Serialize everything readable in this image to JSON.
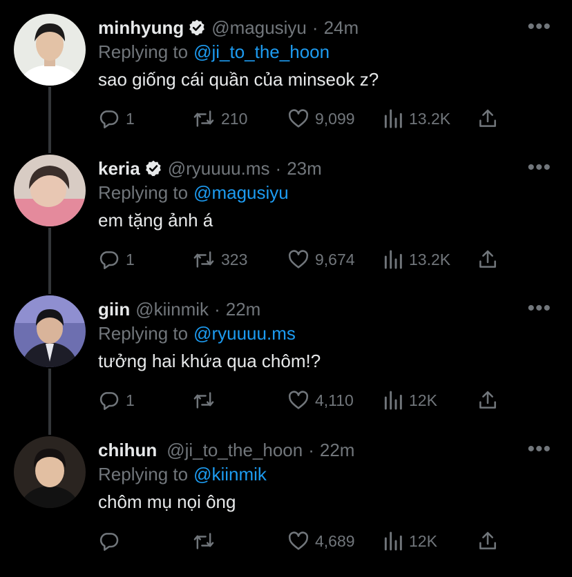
{
  "tweets": [
    {
      "name": "minhyung",
      "verified": true,
      "handle": "@magusiyu",
      "time": "24m",
      "replying_label": "Replying to",
      "replying_to": "@ji_to_the_hoon",
      "text": "sao giống cái quần của minseok z?",
      "replies": "1",
      "retweets": "210",
      "likes": "9,099",
      "views": "13.2K"
    },
    {
      "name": "keria",
      "verified": true,
      "handle": "@ryuuuu.ms",
      "time": "23m",
      "replying_label": "Replying to",
      "replying_to": "@magusiyu",
      "text": "em tặng ảnh á",
      "replies": "1",
      "retweets": "323",
      "likes": "9,674",
      "views": "13.2K"
    },
    {
      "name": "giin",
      "verified": false,
      "handle": "@kiinmik",
      "time": "22m",
      "replying_label": "Replying to",
      "replying_to": "@ryuuuu.ms",
      "text": "tưởng hai khứa qua chôm!?",
      "replies": "1",
      "retweets": "",
      "likes": "4,110",
      "views": "12K"
    },
    {
      "name": "chihun",
      "verified": false,
      "handle": "@ji_to_the_hoon",
      "time": "22m",
      "replying_label": "Replying to",
      "replying_to": "@kiinmik",
      "text": "chôm mụ nọi ông",
      "replies": "",
      "retweets": "",
      "likes": "4,689",
      "views": "12K"
    }
  ],
  "colors": {
    "background": "#000000",
    "text": "#e7e9ea",
    "muted": "#71767b",
    "link": "#1d9bf0"
  },
  "icons": [
    "verified-icon",
    "more-icon",
    "reply-icon",
    "retweet-icon",
    "like-icon",
    "views-icon",
    "share-icon"
  ]
}
